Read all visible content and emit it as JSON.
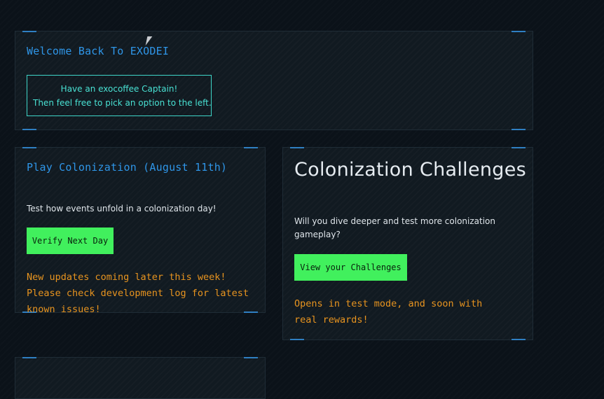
{
  "welcome": {
    "title": "Welcome Back To EXODEI",
    "message_line1": "Have an exocoffee Captain!",
    "message_line2": "Then feel free to pick an option to the left."
  },
  "play_colonization": {
    "title": "Play Colonization (August 11th)",
    "description": "Test how events unfold in a colonization day!",
    "button_label": "Verify Next Day",
    "note": "New updates coming later this week! Please check development log for latest known issues!"
  },
  "challenges": {
    "title": "Colonization Challenges",
    "description": "Will you dive deeper and test more colonization gameplay?",
    "button_label": "View your Challenges",
    "note": "Opens in test mode, and soon with real rewards!"
  },
  "colors": {
    "accent_blue": "#2f96e8",
    "cta_green": "#41f05d",
    "note_orange": "#e8941f",
    "welcome_cyan": "#49e2d4"
  }
}
